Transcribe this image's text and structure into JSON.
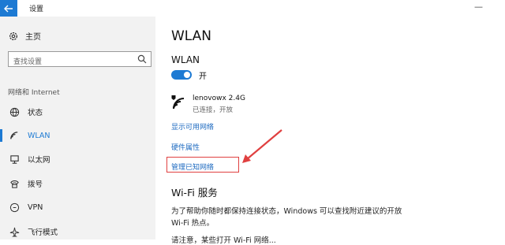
{
  "window": {
    "title": "设置",
    "back_icon": "arrow-left-icon",
    "minimize_glyph": "—"
  },
  "sidebar": {
    "home_label": "主页",
    "search_placeholder": "查找设置",
    "section_label": "网络和 Internet",
    "items": [
      {
        "label": "状态",
        "icon": "globe-icon"
      },
      {
        "label": "WLAN",
        "icon": "wifi-icon",
        "active": true
      },
      {
        "label": "以太网",
        "icon": "ethernet-icon"
      },
      {
        "label": "拨号",
        "icon": "dialup-icon"
      },
      {
        "label": "VPN",
        "icon": "vpn-icon"
      },
      {
        "label": "飞行模式",
        "icon": "airplane-icon"
      }
    ]
  },
  "main": {
    "title": "WLAN",
    "wlan_label": "WLAN",
    "toggle_state": "开",
    "network": {
      "ssid": "lenovowx 2.4G",
      "status": "已连接，开放"
    },
    "links": {
      "show_networks": "显示可用网络",
      "hardware_props": "硬件属性",
      "manage_known": "管理已知网络"
    },
    "wifi_services_heading": "Wi-Fi 服务",
    "wifi_services_text": "为了帮助你随时都保持连接状态，Windows 可以查找附近建议的开放 Wi-Fi 热点。",
    "wifi_services_text_cut": "请注意，某些打开 Wi-Fi 网络..."
  },
  "colors": {
    "accent": "#1d7ad3",
    "annotation": "#e04040"
  }
}
